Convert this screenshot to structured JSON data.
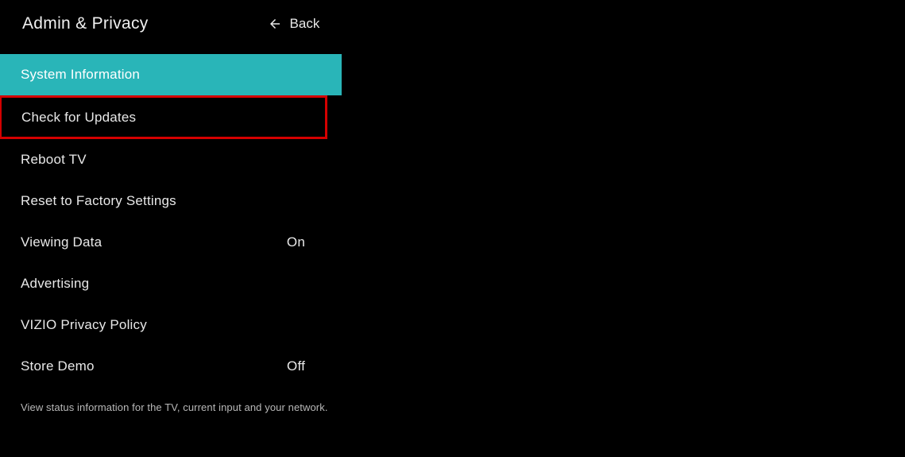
{
  "header": {
    "title": "Admin & Privacy",
    "back_label": "Back"
  },
  "menu": {
    "items": [
      {
        "label": "System Information",
        "value": "",
        "selected": true,
        "highlighted": false
      },
      {
        "label": "Check for Updates",
        "value": "",
        "selected": false,
        "highlighted": true
      },
      {
        "label": "Reboot TV",
        "value": "",
        "selected": false,
        "highlighted": false
      },
      {
        "label": "Reset to Factory Settings",
        "value": "",
        "selected": false,
        "highlighted": false
      },
      {
        "label": "Viewing Data",
        "value": "On",
        "selected": false,
        "highlighted": false
      },
      {
        "label": "Advertising",
        "value": "",
        "selected": false,
        "highlighted": false
      },
      {
        "label": "VIZIO Privacy Policy",
        "value": "",
        "selected": false,
        "highlighted": false
      },
      {
        "label": "Store Demo",
        "value": "Off",
        "selected": false,
        "highlighted": false
      }
    ]
  },
  "description": "View status information for the TV, current input and your network.",
  "colors": {
    "accent": "#29b5b8",
    "highlight_border": "#d40000"
  }
}
